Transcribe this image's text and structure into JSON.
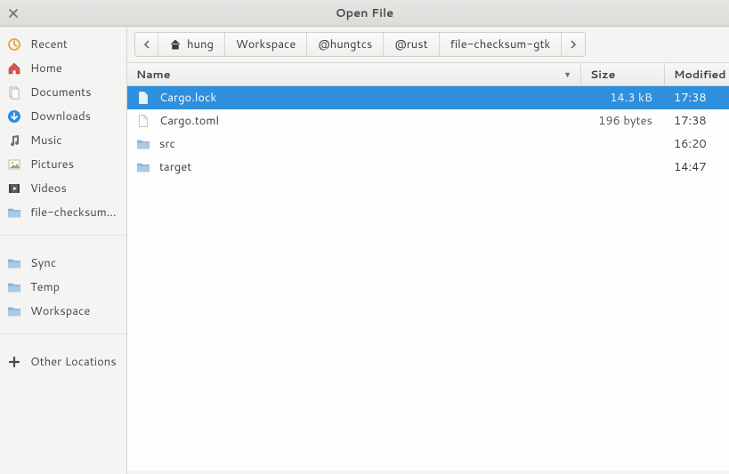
{
  "window": {
    "title": "Open File"
  },
  "sidebar": {
    "places": [
      {
        "label": "Recent",
        "icon": "recent"
      },
      {
        "label": "Home",
        "icon": "home"
      },
      {
        "label": "Documents",
        "icon": "documents"
      },
      {
        "label": "Downloads",
        "icon": "downloads"
      },
      {
        "label": "Music",
        "icon": "music"
      },
      {
        "label": "Pictures",
        "icon": "pictures"
      },
      {
        "label": "Videos",
        "icon": "videos"
      },
      {
        "label": "file-checksum-gtk",
        "icon": "folder"
      }
    ],
    "bookmarks": [
      {
        "label": "Sync",
        "icon": "folder"
      },
      {
        "label": "Temp",
        "icon": "folder"
      },
      {
        "label": "Workspace",
        "icon": "folder"
      }
    ],
    "other": [
      {
        "label": "Other Locations",
        "icon": "plus"
      }
    ]
  },
  "breadcrumb": {
    "segments": [
      "hung",
      "Workspace",
      "@hungtcs",
      "@rust",
      "file-checksum-gtk"
    ]
  },
  "columns": {
    "name": "Name",
    "size": "Size",
    "modified": "Modified"
  },
  "files": [
    {
      "name": "Cargo.lock",
      "size": "14.3 kB",
      "modified": "17:38",
      "type": "file",
      "selected": true
    },
    {
      "name": "Cargo.toml",
      "size": "196 bytes",
      "modified": "17:38",
      "type": "file",
      "selected": false
    },
    {
      "name": "src",
      "size": "",
      "modified": "16:20",
      "type": "folder",
      "selected": false
    },
    {
      "name": "target",
      "size": "",
      "modified": "14:47",
      "type": "folder",
      "selected": false
    }
  ]
}
